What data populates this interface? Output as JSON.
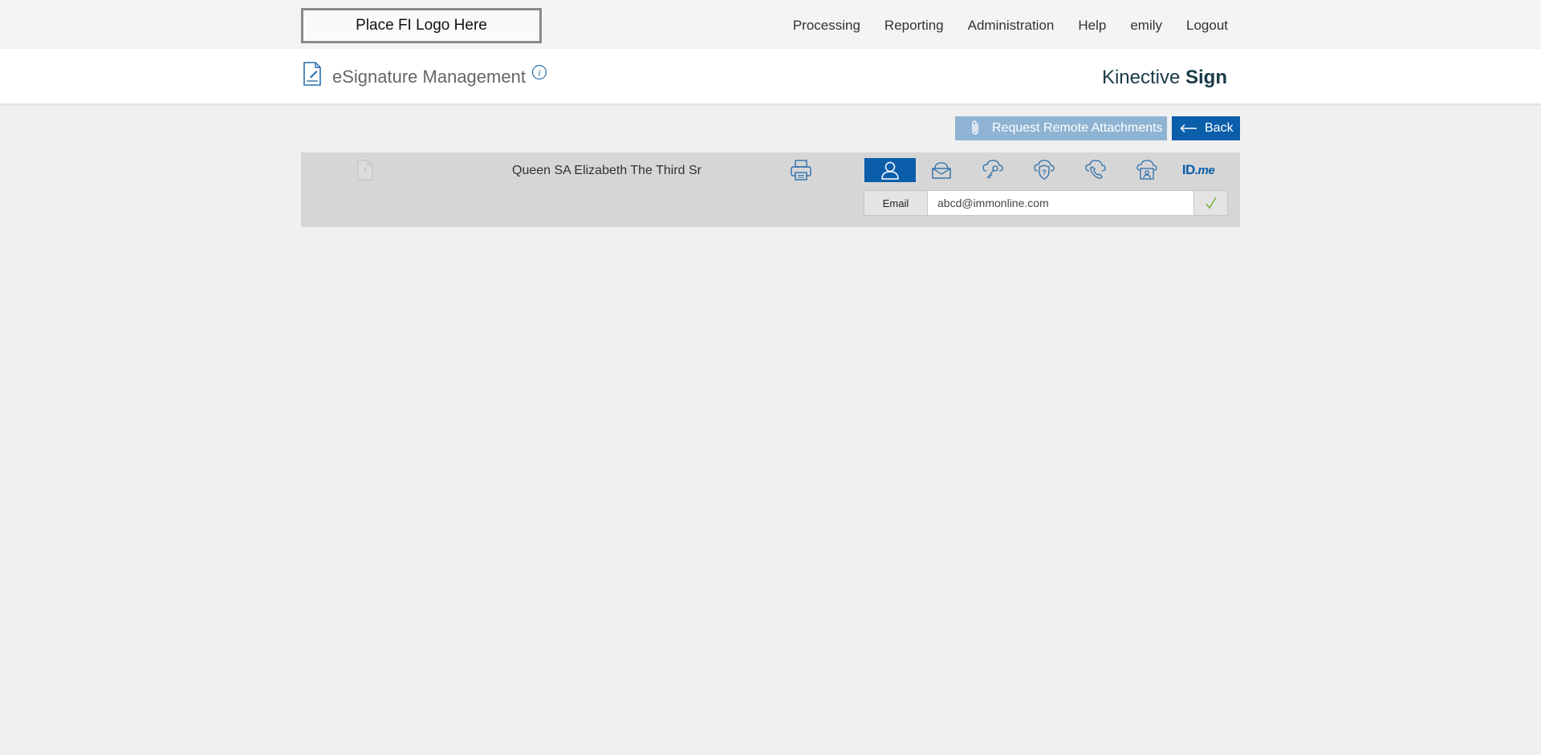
{
  "topbar": {
    "logo_placeholder": "Place FI Logo Here",
    "nav": [
      "Processing",
      "Reporting",
      "Administration",
      "Help",
      "emily",
      "Logout"
    ]
  },
  "header": {
    "title": "eSignature Management",
    "brand_light": "Kinective ",
    "brand_bold": "Sign"
  },
  "actions": {
    "attach_label": "Request Remote Attachments",
    "back_label": "Back"
  },
  "signer": {
    "name": "Queen SA Elizabeth The Third Sr",
    "auth_methods": [
      "email-auth",
      "email-envelope",
      "key-cloud",
      "question-cloud",
      "phone-cloud",
      "id-card-cloud",
      "idme"
    ],
    "idme_label_a": "ID",
    "idme_label_b": ".me",
    "email_label": "Email",
    "email_value": "abcd@immonline.com"
  },
  "colors": {
    "primary": "#0b5eaa",
    "primary_light": "#8fb3d3",
    "panel": "#d6d6d6",
    "background": "#f0f0f0",
    "check": "#7cb342"
  }
}
